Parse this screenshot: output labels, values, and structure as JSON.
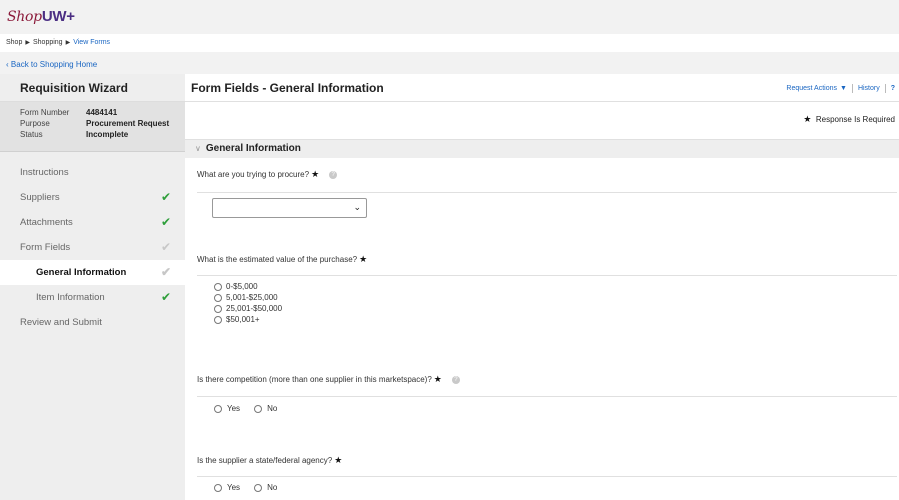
{
  "topbar": {
    "logo_shop": "Shop",
    "logo_uw": "UW+"
  },
  "breadcrumb": {
    "items": [
      "Shop",
      "Shopping",
      "View Forms"
    ]
  },
  "back_link": "Back to Shopping Home",
  "sidebar": {
    "title": "Requisition Wizard",
    "meta": [
      {
        "key": "Form Number",
        "value": "4484141"
      },
      {
        "key": "Purpose",
        "value": "Procurement Request"
      },
      {
        "key": "Status",
        "value": "Incomplete"
      }
    ],
    "nav": [
      {
        "label": "Instructions",
        "check": ""
      },
      {
        "label": "Suppliers",
        "check": "green"
      },
      {
        "label": "Attachments",
        "check": "green"
      },
      {
        "label": "Form Fields",
        "check": "grey"
      },
      {
        "label": "General Information",
        "check": "grey",
        "sub": true,
        "active": true
      },
      {
        "label": "Item Information",
        "check": "green",
        "sub": true
      },
      {
        "label": "Review and Submit",
        "check": ""
      }
    ]
  },
  "main": {
    "title": "Form Fields - General Information",
    "actions": {
      "request_actions": "Request Actions",
      "history": "History",
      "help": "?"
    },
    "required_note": "Response Is Required",
    "section_title": "General Information",
    "q1": {
      "text": "What are you trying to procure?",
      "select_value": ""
    },
    "q2": {
      "text": "What is the estimated value of the purchase?",
      "options": [
        "0-$5,000",
        "5,001-$25,000",
        "25,001-$50,000",
        "$50,001+"
      ]
    },
    "q3": {
      "text": "Is there competition (more than one supplier in this marketspace)?",
      "options": [
        "Yes",
        "No"
      ]
    },
    "q4": {
      "text": "Is the supplier a state/federal agency?",
      "options": [
        "Yes",
        "No"
      ]
    }
  },
  "colors": {
    "accent_link": "#1a66c2",
    "check_green": "#2e9e3a",
    "logo_purple": "#4b2e83"
  }
}
